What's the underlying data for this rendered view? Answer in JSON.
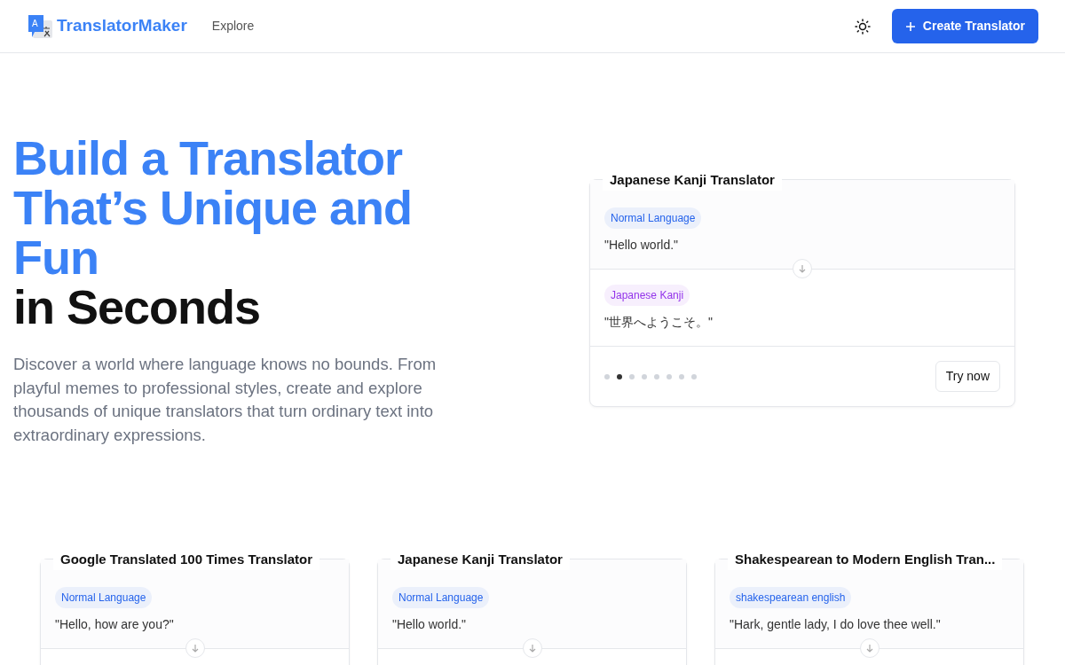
{
  "navbar": {
    "logo_letter": "A",
    "brand": "TranslatorMaker",
    "links": [
      {
        "label": "Explore"
      }
    ],
    "create_button": "Create Translator"
  },
  "hero": {
    "heading_highlight": "Build a Translator That’s Unique and Fun",
    "heading_rest": "in Seconds",
    "description": "Discover a world where language knows no bounds. From playful memes to professional styles, create and explore thousands of unique translators that turn ordinary text into extraordinary expressions."
  },
  "featured": {
    "title": "Japanese Kanji Translator",
    "source": {
      "tag": "Normal Language",
      "color": "#2563eb",
      "text": "\"Hello world.\""
    },
    "target": {
      "tag": "Japanese Kanji",
      "color": "#9333ea",
      "text": "\"世界へようこそ。\""
    },
    "dots": [
      {
        "selected": false
      },
      {
        "selected": true
      },
      {
        "selected": false
      },
      {
        "selected": false
      },
      {
        "selected": false
      },
      {
        "selected": false
      },
      {
        "selected": false
      },
      {
        "selected": false
      }
    ],
    "button": "Try now"
  },
  "cards": [
    {
      "title": "Google Translated 100 Times Translator",
      "source": {
        "tag": "Normal Language",
        "color": "#2563eb",
        "text": "\"Hello, how are you?\""
      }
    },
    {
      "title": "Japanese Kanji Translator",
      "source": {
        "tag": "Normal Language",
        "color": "#2563eb",
        "text": "\"Hello world.\""
      }
    },
    {
      "title": "Shakespearean to Modern English Tran...",
      "source": {
        "tag": "shakespearean english",
        "color": "#2563eb",
        "text": "\"Hark, gentle lady, I do love thee well.\""
      }
    }
  ]
}
